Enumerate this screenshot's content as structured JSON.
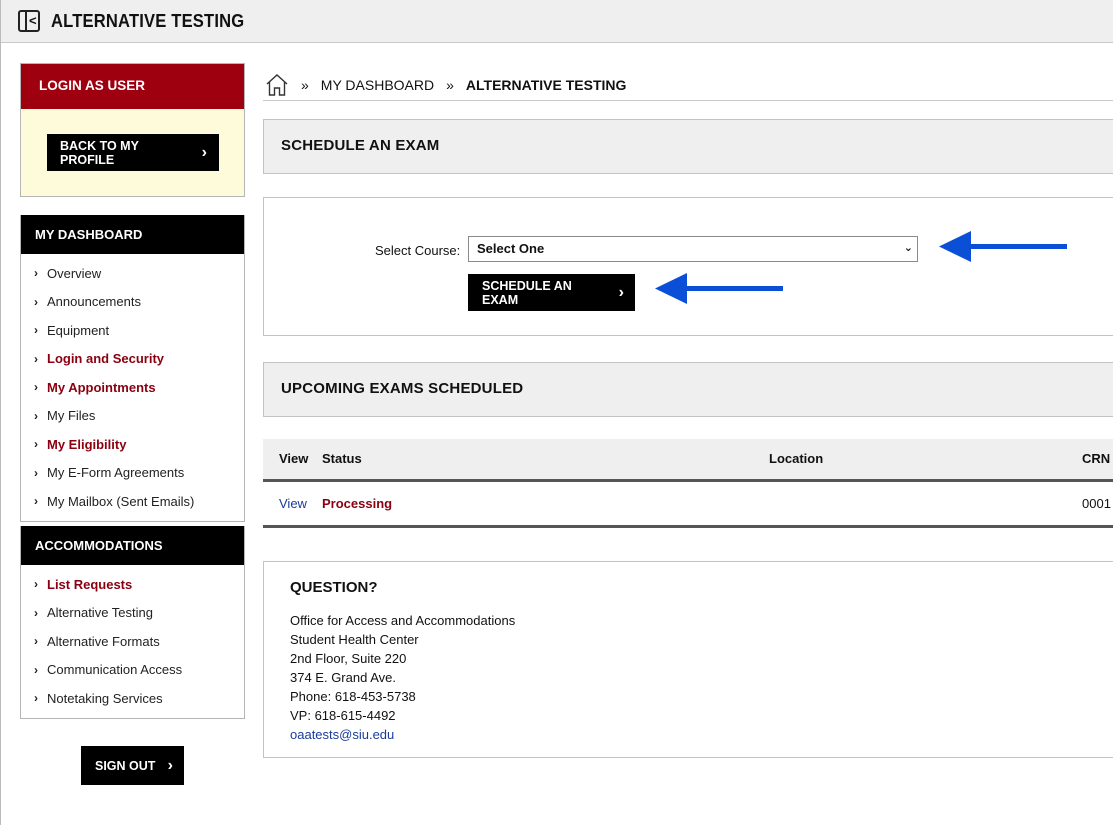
{
  "header": {
    "title": "ALTERNATIVE TESTING",
    "toggle_glyph": "<"
  },
  "login_panel": {
    "title": "LOGIN AS USER",
    "back_button": "BACK TO MY PROFILE"
  },
  "dashboard_menu": {
    "title": "MY DASHBOARD",
    "items": [
      {
        "label": "Overview",
        "highlight": false
      },
      {
        "label": "Announcements",
        "highlight": false
      },
      {
        "label": "Equipment",
        "highlight": false
      },
      {
        "label": "Login and Security",
        "highlight": true
      },
      {
        "label": "My Appointments",
        "highlight": true
      },
      {
        "label": "My Files",
        "highlight": false
      },
      {
        "label": "My Eligibility",
        "highlight": true
      },
      {
        "label": "My E-Form Agreements",
        "highlight": false
      },
      {
        "label": "My Mailbox (Sent Emails)",
        "highlight": false
      }
    ]
  },
  "accommodations_menu": {
    "title": "ACCOMMODATIONS",
    "items": [
      {
        "label": "List Requests",
        "highlight": true
      },
      {
        "label": "Alternative Testing",
        "highlight": false
      },
      {
        "label": "Alternative Formats",
        "highlight": false
      },
      {
        "label": "Communication Access",
        "highlight": false
      },
      {
        "label": "Notetaking Services",
        "highlight": false
      }
    ]
  },
  "sign_out": "SIGN OUT",
  "breadcrumb": {
    "home_icon": "home-icon",
    "parent": "MY DASHBOARD",
    "current": "ALTERNATIVE TESTING",
    "separator": "»"
  },
  "schedule": {
    "title": "SCHEDULE AN EXAM",
    "course_label": "Select Course:",
    "course_value": "Select One",
    "button": "SCHEDULE AN EXAM"
  },
  "upcoming": {
    "title": "UPCOMING EXAMS SCHEDULED",
    "columns": [
      "View",
      "Status",
      "Location",
      "CRN"
    ],
    "rows": [
      {
        "view": "View",
        "status": "Processing",
        "location": "",
        "crn": "0001"
      }
    ]
  },
  "question": {
    "title": "QUESTION?",
    "lines": [
      "Office for Access and Accommodations",
      "Student Health Center",
      "2nd Floor, Suite 220",
      "374 E. Grand Ave.",
      "Phone: 618-453-5738",
      "VP: 618-615-4492"
    ],
    "email": "oaatests@siu.edu"
  },
  "colors": {
    "brand_red": "#9e0010",
    "link_blue": "#1a3c9c",
    "annotation_arrow": "#0a4fd6",
    "login_bg": "#fdfbd9"
  }
}
